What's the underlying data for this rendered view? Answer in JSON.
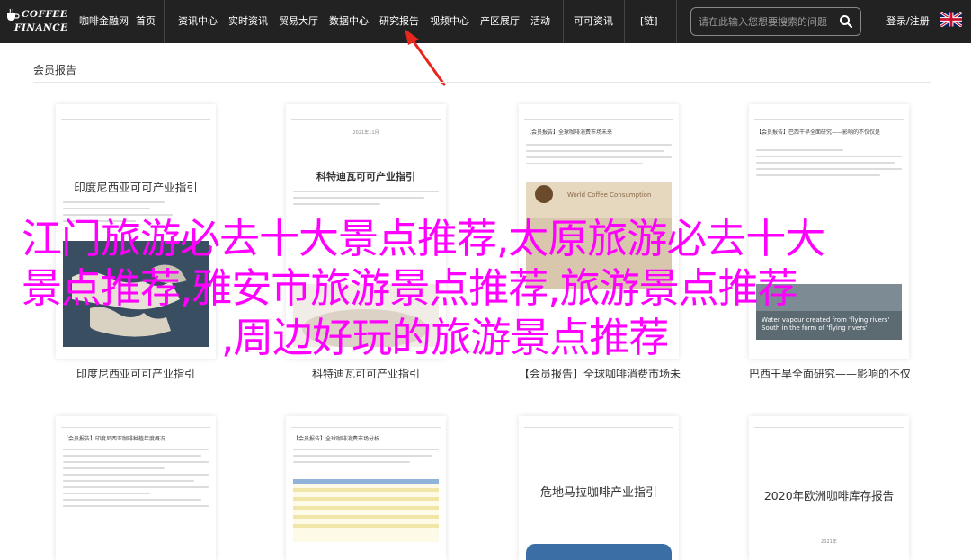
{
  "brand": {
    "line1": "COFFEE",
    "line2": "FINANCE"
  },
  "nav": {
    "items": [
      {
        "label": "咖啡金融网"
      },
      {
        "label": "首页"
      },
      {
        "label": "资讯中心"
      },
      {
        "label": "实时资讯"
      },
      {
        "label": "贸易大厅"
      },
      {
        "label": "数据中心"
      },
      {
        "label": "研究报告"
      },
      {
        "label": "视频中心"
      },
      {
        "label": "产区展厅"
      },
      {
        "label": "活动"
      },
      {
        "label": "可可资讯"
      },
      {
        "label": "[链]"
      }
    ],
    "search_placeholder": "请在此输入您想要搜索的问题",
    "login_label": "登录/注册"
  },
  "colors": {
    "nav_bg": "#222222",
    "overlay_text": "#ff00ff",
    "arrow": "#e8261d"
  },
  "section": {
    "title": "会员报告"
  },
  "overlay": {
    "line1": "江门旅游必去十大景点推荐,太原旅游必去十大",
    "line2": "景点推荐,雅安市旅游景点推荐,旅游景点推荐",
    "line3": ",周边好玩的旅游景点推荐"
  },
  "cards": [
    {
      "doc_title": "印度尼西亚可可产业指引",
      "caption": "印度尼西亚可可产业指引"
    },
    {
      "doc_title": "科特迪瓦可可产业指引",
      "sub": "2021年11月",
      "caption": "科特迪瓦可可产业指引"
    },
    {
      "doc_tag": "【会员报告】全球咖啡消费市场未来",
      "chart_label": "World Coffee Consumption",
      "caption": "【会员报告】全球咖啡消费市场未"
    },
    {
      "doc_tag": "【会员报告】巴西干旱全面研究——影响的不仅仅是",
      "img_caption1": "Water vapour created from 'flying rivers'",
      "img_caption2": "South in the form of 'flying rivers'",
      "caption": "巴西干旱全面研究——影响的不仅"
    },
    {
      "doc_tag": "【会员报告】印度尼西亚咖啡种植年度概况",
      "caption": ""
    },
    {
      "doc_tag": "【会员报告】全球咖啡消费市场分析",
      "caption": ""
    },
    {
      "doc_title": "危地马拉咖啡产业指引",
      "caption": ""
    },
    {
      "doc_title": "2020年欧洲咖啡库存报告",
      "sub": "2021年",
      "caption": ""
    }
  ]
}
